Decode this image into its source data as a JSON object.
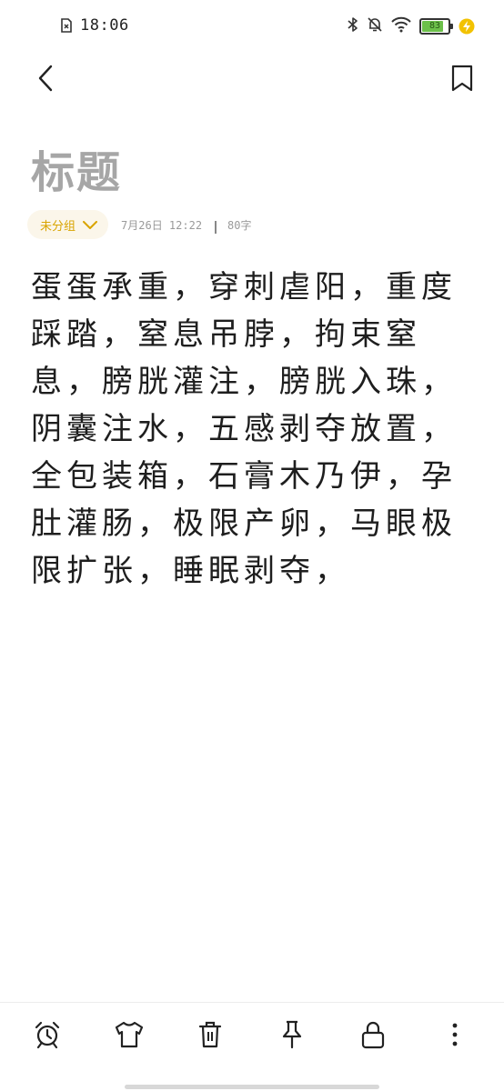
{
  "status_bar": {
    "time": "18:06",
    "battery_level": "83",
    "battery_percent": 83,
    "battery_color": "#6cc04a",
    "charge_color": "#f2c200"
  },
  "nav": {
    "back_icon": "chevron-left-icon",
    "bookmark_icon": "bookmark-icon"
  },
  "note": {
    "title": "标题",
    "group": "未分组",
    "date": "7月26日 12:22",
    "word_count": "80字",
    "body": "蛋蛋承重，穿刺虐阳，重度踩踏，窒息吊脖，拘束窒息，膀胱灌注，膀胱入珠，阴囊注水，五感剥夺放置，全包装箱，石膏木乃伊，孕肚灌肠，极限产卵，马眼极限扩张，睡眠剥夺，"
  },
  "toolbar": {
    "icons": [
      "alarm-clock-icon",
      "shirt-icon",
      "trash-icon",
      "pin-icon",
      "lock-icon",
      "more-vertical-icon"
    ]
  },
  "colors": {
    "accent": "#d9a400",
    "title_gray": "#a6a6a6"
  }
}
